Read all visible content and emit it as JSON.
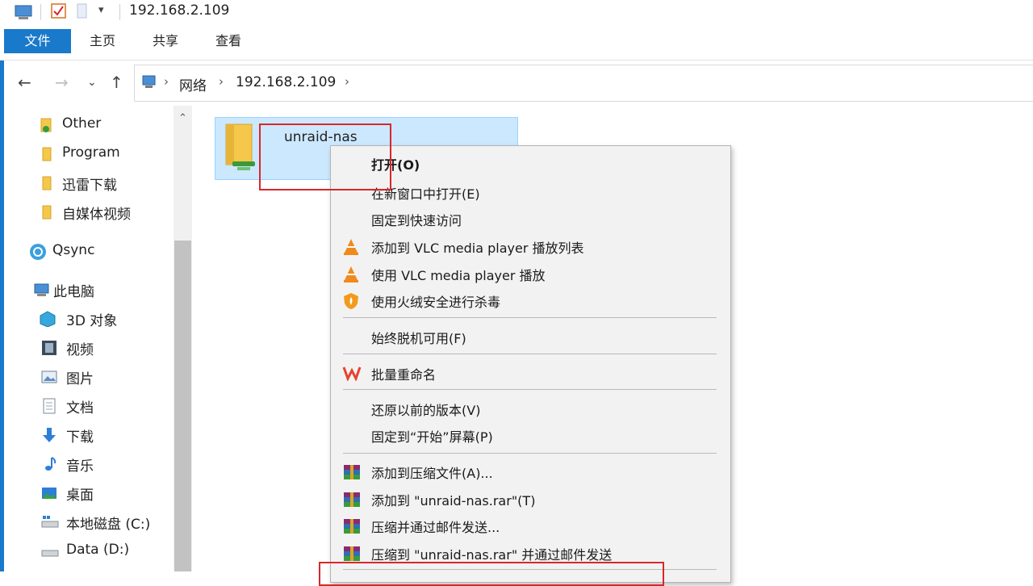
{
  "window": {
    "title": "192.168.2.109",
    "qat_more": "▾"
  },
  "ribbon": {
    "tabs": [
      "文件",
      "主页",
      "共享",
      "查看"
    ]
  },
  "address": {
    "back": "←",
    "forward": "→",
    "recent": "⌄",
    "up": "↑",
    "crumbs": [
      "网络",
      "192.168.2.109"
    ],
    "sep": "›"
  },
  "sidebar": {
    "items": [
      {
        "label": "Other",
        "icon": "folder-icon"
      },
      {
        "label": "Program",
        "icon": "folder-icon"
      },
      {
        "label": "迅雷下载",
        "icon": "folder-icon"
      },
      {
        "label": "自媒体视频",
        "icon": "folder-icon"
      },
      {
        "label": "Qsync",
        "icon": "qsync-icon"
      },
      {
        "label": "此电脑",
        "icon": "computer-icon"
      },
      {
        "label": "3D 对象",
        "icon": "3d-objects-icon"
      },
      {
        "label": "视频",
        "icon": "video-icon"
      },
      {
        "label": "图片",
        "icon": "pictures-icon"
      },
      {
        "label": "文档",
        "icon": "documents-icon"
      },
      {
        "label": "下载",
        "icon": "download-icon"
      },
      {
        "label": "音乐",
        "icon": "music-icon"
      },
      {
        "label": "桌面",
        "icon": "desktop-icon"
      },
      {
        "label": "本地磁盘 (C:)",
        "icon": "drive-icon"
      },
      {
        "label": "Data (D:)",
        "icon": "drive-icon"
      }
    ],
    "scroll_up": "⌃"
  },
  "content": {
    "file_name": "unraid-nas"
  },
  "context_menu": {
    "items": [
      {
        "label": "打开(O)",
        "icon": ""
      },
      {
        "label": "在新窗口中打开(E)",
        "icon": ""
      },
      {
        "label": "固定到快速访问",
        "icon": ""
      },
      {
        "label": "添加到 VLC media player 播放列表",
        "icon": "vlc-icon"
      },
      {
        "label": "使用 VLC media player 播放",
        "icon": "vlc-icon"
      },
      {
        "label": "使用火绒安全进行杀毒",
        "icon": "huorong-icon"
      },
      {
        "label": "始终脱机可用(F)",
        "icon": ""
      },
      {
        "label": "批量重命名",
        "icon": "wps-icon"
      },
      {
        "label": "还原以前的版本(V)",
        "icon": ""
      },
      {
        "label": "固定到“开始”屏幕(P)",
        "icon": ""
      },
      {
        "label": "添加到压缩文件(A)...",
        "icon": "winrar-icon"
      },
      {
        "label": "添加到 \"unraid-nas.rar\"(T)",
        "icon": "winrar-icon"
      },
      {
        "label": "压缩并通过邮件发送...",
        "icon": "winrar-icon"
      },
      {
        "label": "压缩到 \"unraid-nas.rar\" 并通过邮件发送",
        "icon": "winrar-icon"
      }
    ]
  },
  "colors": {
    "accent": "#1979ca",
    "selection": "#cce8ff",
    "annotation": "#d9262b",
    "menu_bg": "#f2f2f2"
  }
}
